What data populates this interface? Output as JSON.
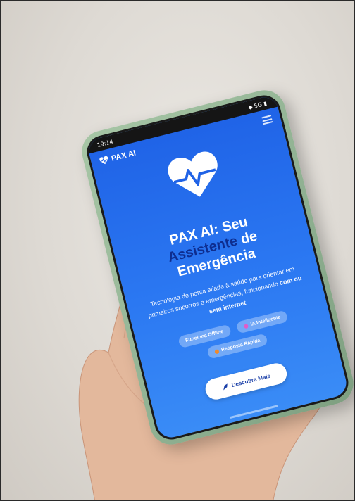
{
  "status_bar": {
    "time": "19:14",
    "right": "◆ 5G ▮"
  },
  "app": {
    "brand": "PAX AI",
    "menu_icon": "hamburger-icon"
  },
  "hero": {
    "headline_part1": "PAX AI: Seu",
    "headline_accent": "Assistente",
    "headline_part2": "de Emergência",
    "tagline_text": "Tecnologia de ponta aliada à saúde para orientar em primeiros socorros e emergências, funcionando",
    "tagline_bold": "com ou sem internet"
  },
  "chips": [
    {
      "label": "Funciona Offline",
      "dot": ""
    },
    {
      "label": "IA Inteligente",
      "dot": "#e05cc9"
    },
    {
      "label": "Resposta Rápida",
      "dot": "#f08a2c"
    }
  ],
  "cta": {
    "label": "Descubra Mais"
  },
  "colors": {
    "screen_top": "#1f62e6",
    "screen_bottom": "#3a8cf6",
    "accent_text": "#0e2d8f",
    "phone_case": "#9ebd9f"
  }
}
